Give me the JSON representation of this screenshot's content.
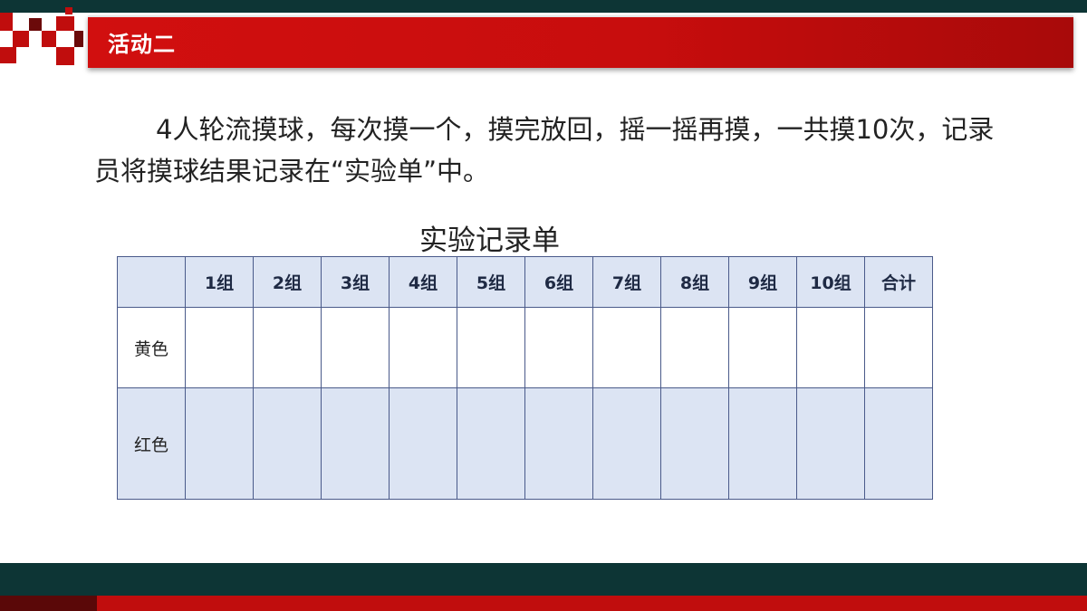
{
  "slide": {
    "title": "活动二",
    "paragraph": "4人轮流摸球，每次摸一个，摸完放回，摇一摇再摸，一共摸10次，记录员将摸球结果记录在“实验单”中。",
    "table_title": "实验记录单"
  },
  "table": {
    "corner": "",
    "columns": [
      "1组",
      "2组",
      "3组",
      "4组",
      "5组",
      "6组",
      "7组",
      "8组",
      "9组",
      "10组",
      "合计"
    ],
    "rows": [
      {
        "label": "黄色",
        "cells": [
          "",
          "",
          "",
          "",
          "",
          "",
          "",
          "",
          "",
          "",
          ""
        ]
      },
      {
        "label": "红色",
        "cells": [
          "",
          "",
          "",
          "",
          "",
          "",
          "",
          "",
          "",
          "",
          ""
        ]
      }
    ]
  },
  "colors": {
    "title_red": "#c80d0d",
    "dark_teal": "#0d3535",
    "table_header_fill": "#dce4f3"
  }
}
